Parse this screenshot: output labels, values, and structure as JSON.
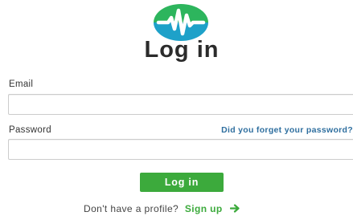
{
  "logo": {
    "icon": "waveform-logo-icon",
    "colors": {
      "top": "#2db55d",
      "bottom": "#1ea1c9",
      "wave": "#ffffff"
    }
  },
  "heading": {
    "title": "Log in"
  },
  "form": {
    "email_label": "Email",
    "email_value": "",
    "password_label": "Password",
    "password_value": "",
    "forgot_link": "Did you forget your password?",
    "submit_label": "Log in"
  },
  "footer": {
    "prompt": "Don't have a profile?",
    "signup_link": "Sign up",
    "arrow_icon": "arrow-right-icon"
  },
  "colors": {
    "accent_green": "#3caa3c",
    "link_blue": "#2f6f9f"
  }
}
